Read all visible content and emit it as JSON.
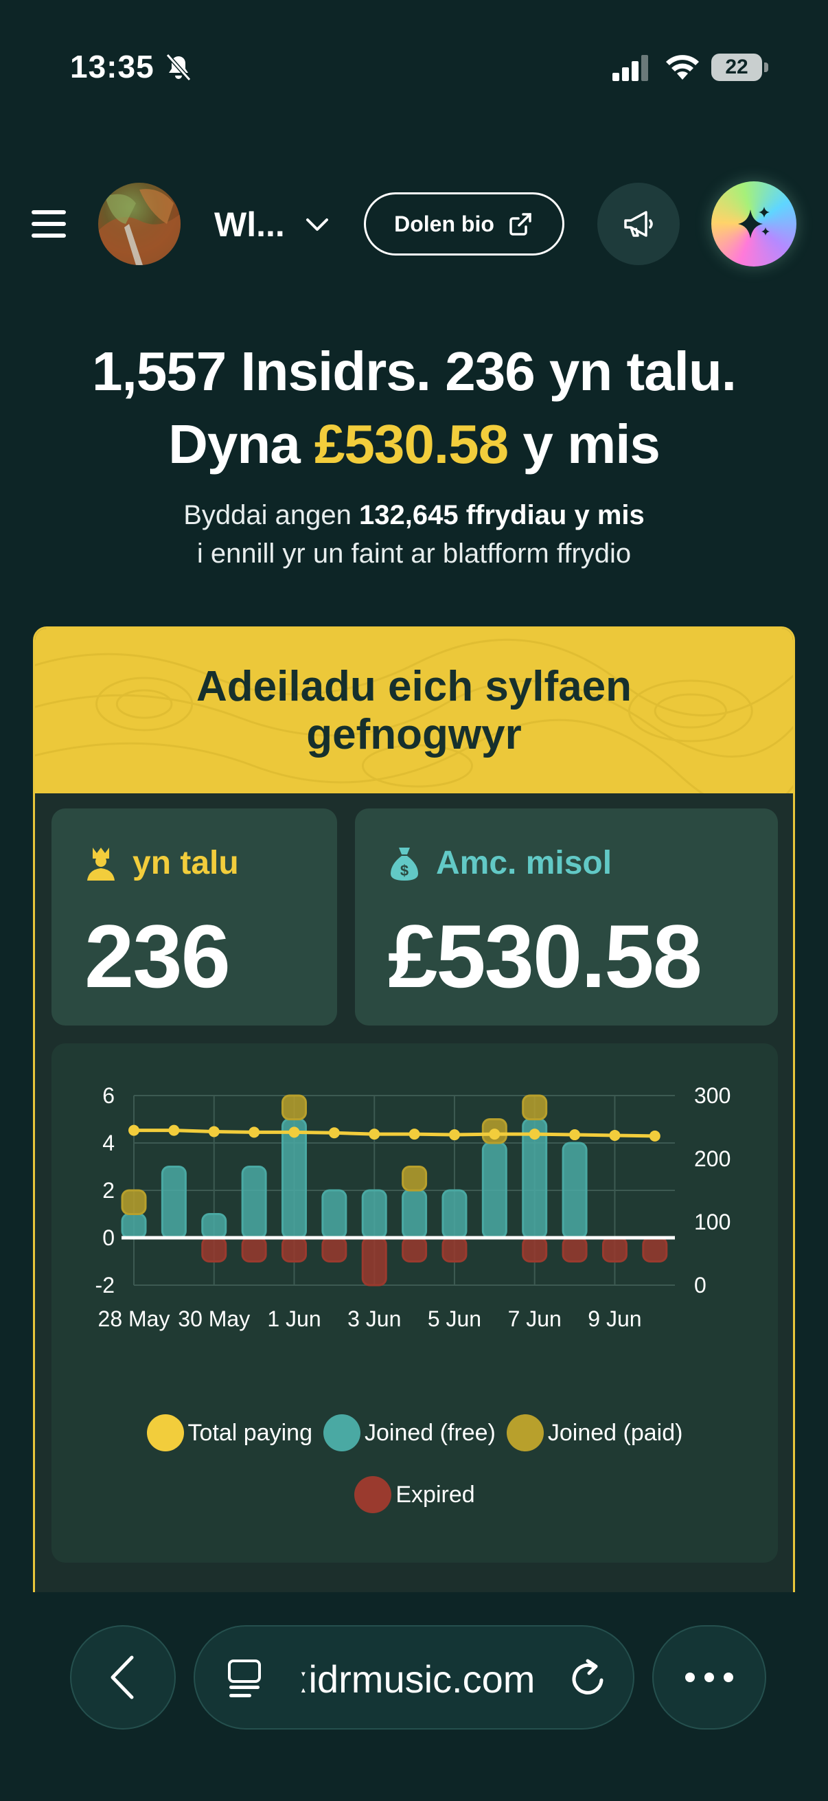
{
  "status": {
    "time": "13:35",
    "battery": "22"
  },
  "topbar": {
    "account_name": "Wl...",
    "bio_button": "Dolen bio"
  },
  "hero": {
    "line1": "1,557 Insidrs. 236 yn talu.",
    "line2_prefix": "Dyna ",
    "line2_amount": "£530.58",
    "line2_suffix": " y mis",
    "sub_prefix": "Byddai angen ",
    "sub_bold": "132,645 ffrydiau y mis",
    "sub_line2": "i ennill yr un faint ar blatfform ffrydio"
  },
  "card": {
    "title": "Adeiladu eich sylfaen gefnogwyr",
    "paying_label": "yn talu",
    "paying_value": "236",
    "monthly_label": "Amc. misol",
    "monthly_value": "£530.58"
  },
  "colors": {
    "accent_yellow": "#f2cd3c",
    "teal": "#4aa9a3",
    "olive": "#b8a02c",
    "red": "#9a3a2e",
    "background": "#0d2526"
  },
  "chart_data": {
    "type": "bar",
    "categories": [
      "28 May",
      "29 May",
      "30 May",
      "31 May",
      "1 Jun",
      "2 Jun",
      "3 Jun",
      "4 Jun",
      "5 Jun",
      "6 Jun",
      "7 Jun",
      "8 Jun",
      "9 Jun",
      "10 Jun"
    ],
    "x_tick_labels": [
      "28 May",
      "30 May",
      "1 Jun",
      "3 Jun",
      "5 Jun",
      "7 Jun",
      "9 Jun"
    ],
    "ylim": [
      -2,
      6
    ],
    "y_ticks": [
      "6",
      "4",
      "2",
      "0",
      "-2"
    ],
    "y2lim": [
      0,
      300
    ],
    "y2_ticks": [
      "300",
      "200",
      "100",
      "0"
    ],
    "grid": true,
    "legend_position": "bottom",
    "series": [
      {
        "name": "Total paying",
        "axis": "right",
        "type": "line",
        "color": "#f2cd3c",
        "values": [
          245,
          245,
          243,
          242,
          242,
          241,
          239,
          239,
          238,
          239,
          239,
          238,
          237,
          236
        ]
      },
      {
        "name": "Joined (free)",
        "axis": "left",
        "type": "bar",
        "color": "#4aa9a3",
        "values": [
          1,
          3,
          1,
          3,
          5,
          2,
          2,
          2,
          2,
          4,
          5,
          4,
          0,
          0
        ]
      },
      {
        "name": "Joined (paid)",
        "axis": "left",
        "type": "bar",
        "color": "#b8a02c",
        "values": [
          1,
          0,
          0,
          0,
          1,
          0,
          0,
          1,
          0,
          1,
          1,
          0,
          0,
          0
        ]
      },
      {
        "name": "Expired",
        "axis": "left",
        "type": "bar",
        "color": "#9a3a2e",
        "values": [
          0,
          0,
          -1,
          -1,
          -1,
          -1,
          -2,
          -1,
          -1,
          0,
          -1,
          -1,
          -1,
          -1
        ]
      }
    ]
  },
  "browser": {
    "url": "ːidrmusic.com"
  }
}
